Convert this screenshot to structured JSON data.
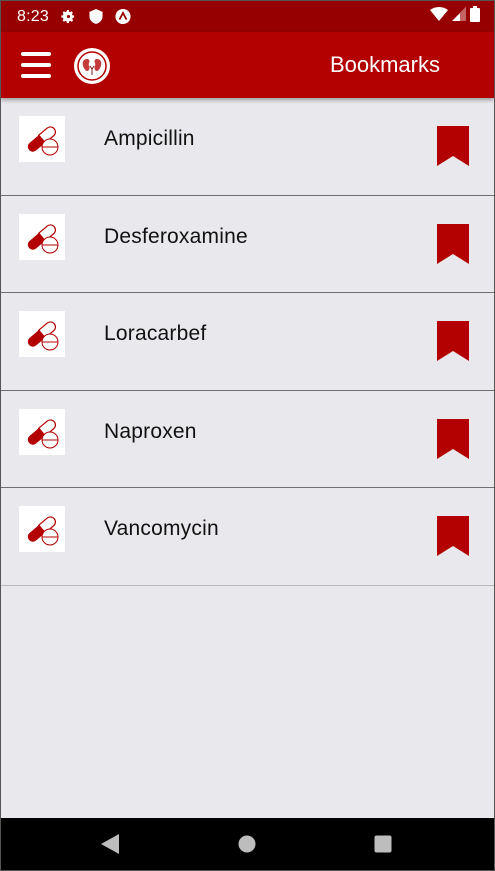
{
  "status_bar": {
    "time": "8:23",
    "icons_left": [
      "settings-gear-icon",
      "shield-icon",
      "vpn-icon"
    ],
    "icons_right": [
      "wifi-icon",
      "signal-icon",
      "battery-icon"
    ]
  },
  "app_bar": {
    "title": "Bookmarks",
    "menu_icon": "hamburger-menu-icon",
    "logo_icon": "kidney-logo-icon"
  },
  "bookmarks": [
    {
      "name": "Ampicillin",
      "icon": "pill-capsule-icon",
      "bookmarked": true
    },
    {
      "name": "Desferoxamine",
      "icon": "pill-capsule-icon",
      "bookmarked": true
    },
    {
      "name": "Loracarbef",
      "icon": "pill-capsule-icon",
      "bookmarked": true
    },
    {
      "name": "Naproxen",
      "icon": "pill-capsule-icon",
      "bookmarked": true
    },
    {
      "name": "Vancomycin",
      "icon": "pill-capsule-icon",
      "bookmarked": true
    }
  ],
  "nav_bar": {
    "buttons": [
      "back-icon",
      "home-icon",
      "recents-icon"
    ]
  },
  "colors": {
    "status_bar": "#960000",
    "app_bar": "#b30000",
    "accent": "#b30000",
    "background": "#e9e8ed"
  }
}
